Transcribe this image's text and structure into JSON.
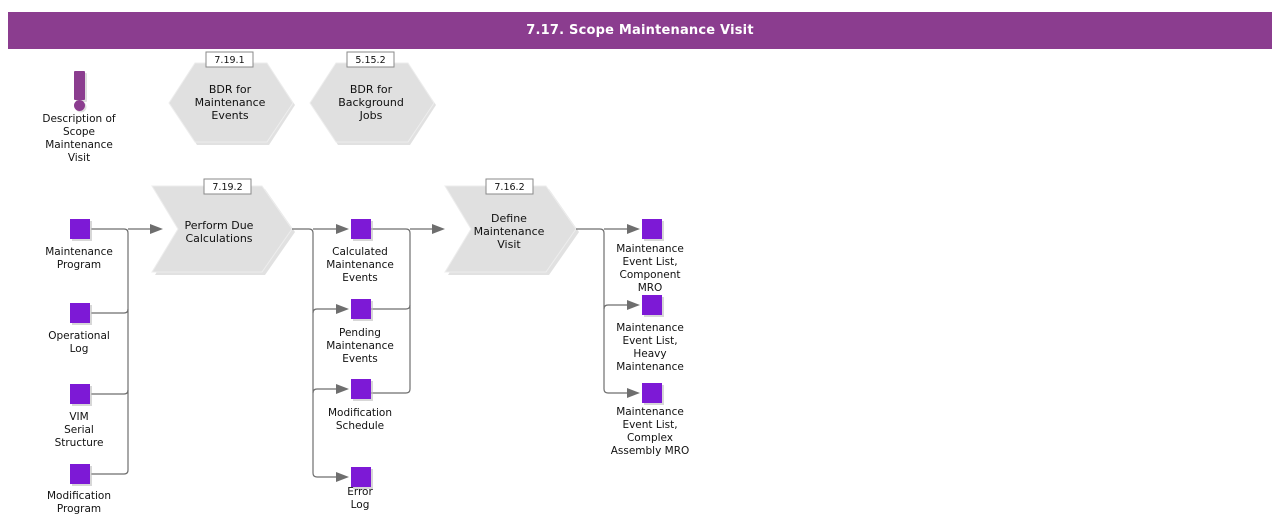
{
  "header": {
    "title": "7.17. Scope Maintenance Visit",
    "bar_color": "#8B3D8F",
    "text_color": "#FFFFFF"
  },
  "theme": {
    "node_color": "#7D19D6",
    "shape_fill": "#E0E0E0",
    "connector_color": "#6E6E6E",
    "canvas_background": "#FFFFFF"
  },
  "chart_data": {
    "type": "diagram",
    "title": "7.17. Scope Maintenance Visit",
    "notation": "business-process-flow"
  },
  "description_note": {
    "icon": "exclamation-icon",
    "label": "Description of\nScope\nMaintenance\nVisit",
    "lines": [
      "Description of",
      "Scope",
      "Maintenance",
      "Visit"
    ]
  },
  "hexagons": [
    {
      "tag": "7.19.1",
      "lines": [
        "BDR for",
        "Maintenance",
        "Events"
      ],
      "name": "bdr-maintenance-events"
    },
    {
      "tag": "5.15.2",
      "lines": [
        "BDR for",
        "Background",
        "Jobs"
      ],
      "name": "bdr-background-jobs"
    }
  ],
  "processes": [
    {
      "tag": "7.19.2",
      "lines": [
        "Perform Due",
        "Calculations"
      ],
      "name": "perform-due-calculations"
    },
    {
      "tag": "7.16.2",
      "lines": [
        "Define",
        "Maintenance",
        "Visit"
      ],
      "name": "define-maintenance-visit"
    }
  ],
  "inputs": [
    {
      "lines": [
        "Maintenance",
        "Program"
      ],
      "name": "maintenance-program"
    },
    {
      "lines": [
        "Operational",
        "Log"
      ],
      "name": "operational-log"
    },
    {
      "lines": [
        "VIM",
        "Serial",
        "Structure"
      ],
      "name": "vim-serial-structure"
    },
    {
      "lines": [
        "Modification",
        "Program"
      ],
      "name": "modification-program"
    }
  ],
  "intermediates": [
    {
      "lines": [
        "Calculated",
        "Maintenance",
        "Events"
      ],
      "name": "calculated-maintenance-events"
    },
    {
      "lines": [
        "Pending",
        "Maintenance",
        "Events"
      ],
      "name": "pending-maintenance-events"
    },
    {
      "lines": [
        "Modification",
        "Schedule"
      ],
      "name": "modification-schedule"
    },
    {
      "lines": [
        "Error",
        "Log"
      ],
      "name": "error-log"
    }
  ],
  "outputs": [
    {
      "lines": [
        "Maintenance",
        "Event List,",
        "Component",
        "MRO"
      ],
      "name": "maintenance-event-list-component-mro"
    },
    {
      "lines": [
        "Maintenance",
        "Event List,",
        "Heavy",
        "Maintenance"
      ],
      "name": "maintenance-event-list-heavy-maintenance"
    },
    {
      "lines": [
        "Maintenance",
        "Event List,",
        "Complex",
        "Assembly MRO"
      ],
      "name": "maintenance-event-list-complex-assembly-mro"
    }
  ]
}
